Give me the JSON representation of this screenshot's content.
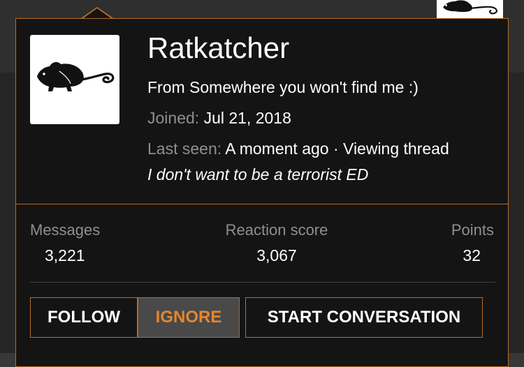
{
  "profile": {
    "username": "Ratkatcher",
    "location": "From Somewhere you won't find me :)",
    "joined_label": "Joined:",
    "joined_value": "Jul 21, 2018",
    "last_seen_label": "Last seen:",
    "last_seen_value": "A moment ago · Viewing thread",
    "signature": "I don't want to be a terrorist ED",
    "avatar_icon": "rat-icon"
  },
  "stats": {
    "messages_label": "Messages",
    "messages_value": "3,221",
    "reaction_label": "Reaction score",
    "reaction_value": "3,067",
    "points_label": "Points",
    "points_value": "32"
  },
  "actions": {
    "follow_label": "FOLLOW",
    "ignore_label": "IGNORE",
    "conversation_label": "START CONVERSATION"
  },
  "colors": {
    "accent": "#b86d2a",
    "ignore_text": "#e3862f",
    "tooltip_bg": "#141414",
    "muted_text": "#8f8f8f"
  }
}
